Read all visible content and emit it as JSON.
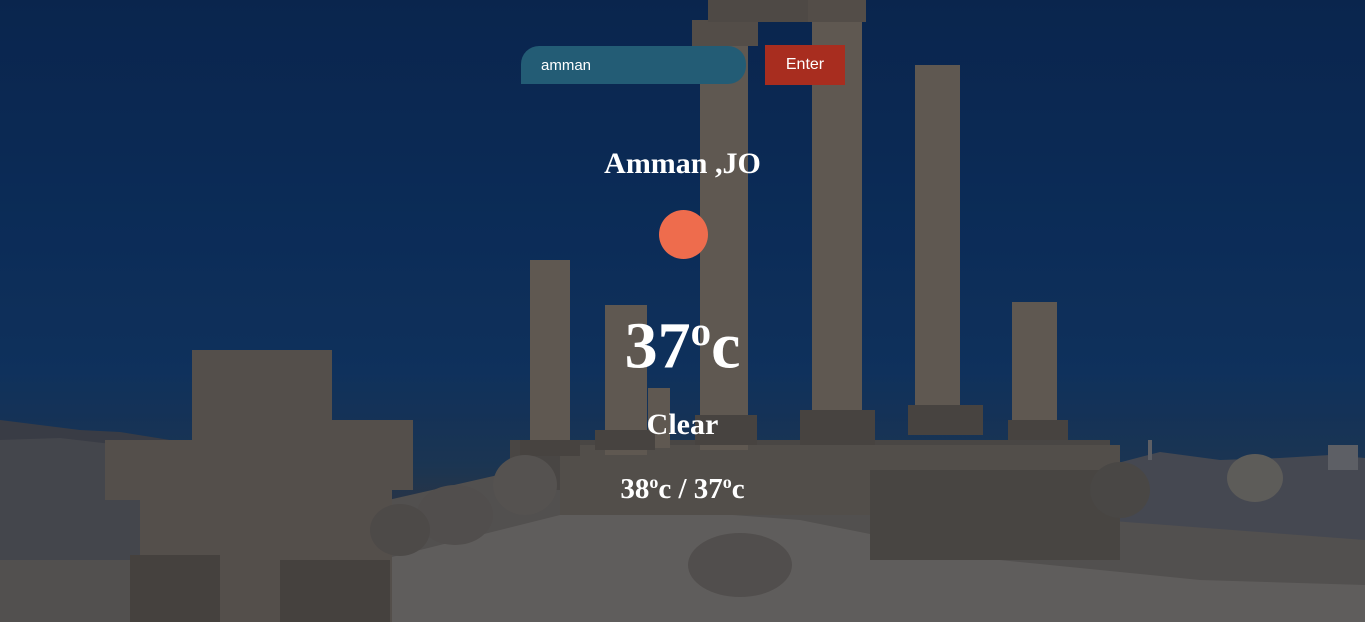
{
  "search": {
    "value": "amman",
    "button_label": "Enter"
  },
  "weather": {
    "city": "Amman ,JO",
    "icon": "sun-icon",
    "temp_value": "37",
    "temp_unit_sup": "o",
    "temp_unit": "c",
    "condition": "Clear",
    "high": "38",
    "low": "37",
    "separator": " / "
  },
  "colors": {
    "input_bg": "#235c75",
    "button_bg": "#a82d1f",
    "sun": "#ee6c4d",
    "sky": "#0b2b59"
  }
}
